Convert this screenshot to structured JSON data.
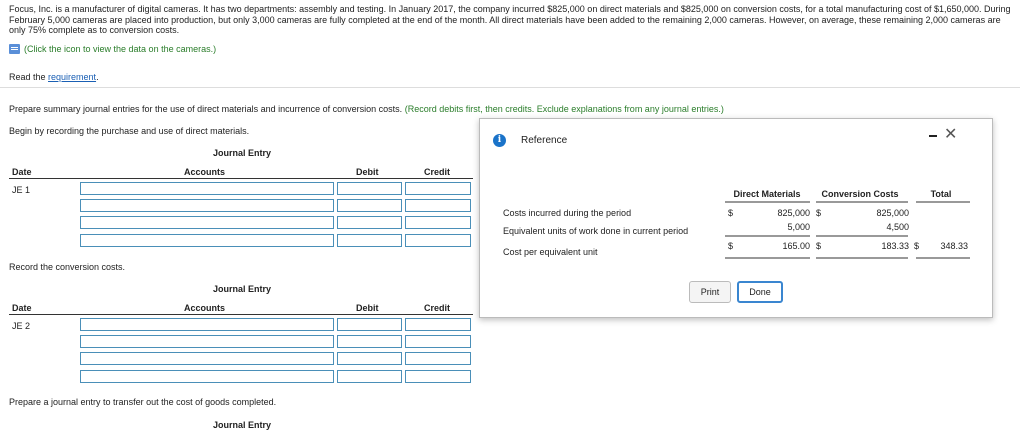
{
  "problem_text": "Focus, Inc. is a manufacturer of digital cameras. It has two departments: assembly and testing. In January 2017, the company incurred $825,000 on direct materials and $825,000 on conversion costs, for a total manufacturing cost of $1,650,000. During February 5,000 cameras are placed into production, but only 3,000 cameras are fully completed at the end of the month. All direct materials have been added to the remaining 2,000 cameras. However, on average, these remaining 2,000 cameras are only 75% complete as to conversion costs.",
  "hint_text": "(Click the icon to view the data on the cameras.)",
  "read_prefix": "Read the ",
  "read_link": "requirement",
  "read_suffix": ".",
  "instruction_main": "Prepare summary journal entries for the use of direct materials and incurrence of conversion costs.",
  "instruction_note": "(Record debits first, then credits. Exclude explanations from any journal entries.)",
  "section1_label": "Begin by recording the purchase and use of direct materials.",
  "section2_label": "Record the conversion costs.",
  "section3_label": "Prepare a journal entry to transfer out the cost of goods completed.",
  "journal_entry_title": "Journal Entry",
  "columns": {
    "date": "Date",
    "accounts": "Accounts",
    "debit": "Debit",
    "credit": "Credit"
  },
  "je1_label": "JE 1",
  "je2_label": "JE 2",
  "reference": {
    "title": "Reference",
    "headers": {
      "dm": "Direct Materials",
      "cc": "Conversion Costs",
      "total": "Total"
    },
    "rows": [
      {
        "label": "Costs incurred during the period",
        "dm_cur": "$",
        "dm": "825,000",
        "dm_cur2": "$",
        "cc": "825,000",
        "cc_cur": "",
        "total": ""
      },
      {
        "label": "Equivalent units of work done in current period",
        "dm_cur": "",
        "dm": "5,000",
        "dm_cur2": "",
        "cc": "4,500",
        "cc_cur": "",
        "total": ""
      },
      {
        "label": "Cost per equivalent unit",
        "dm_cur": "$",
        "dm": "165.00",
        "dm_cur2": "$",
        "cc": "183.33",
        "cc_cur": "$",
        "total": "348.33"
      }
    ],
    "print_label": "Print",
    "done_label": "Done"
  },
  "colors": {
    "link": "#1a5fb4",
    "green": "#2a7d2a",
    "input_border": "#4a8fb8",
    "info": "#1a73c9"
  }
}
